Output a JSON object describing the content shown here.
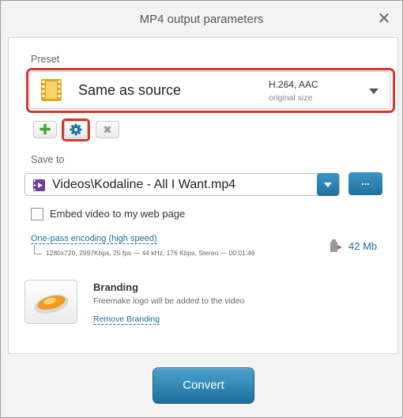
{
  "window": {
    "title": "MP4 output parameters",
    "close_icon": "close-icon"
  },
  "preset": {
    "label": "Preset",
    "name": "Same as source",
    "codec": "H.264, AAC",
    "size": "original size",
    "icon": "film-icon"
  },
  "preset_buttons": {
    "add_icon": "plus-icon",
    "edit_icon": "gear-icon",
    "delete_icon": "delete-icon"
  },
  "save_to": {
    "label": "Save to",
    "path": "Videos\\Kodaline - All I Want.mp4",
    "browse_label": "..."
  },
  "embed": {
    "label": "Embed video to my web page",
    "checked": false
  },
  "encoding": {
    "mode_link": "One-pass encoding (high speed)",
    "details": "1280x720, 2997Kbps, 25 fps — 44 kHz, 176 Kbps, Stereo — 00:01:46",
    "file_size": "42 Mb"
  },
  "branding": {
    "title": "Branding",
    "description": "Freemake logo will be added to the video",
    "remove_link": "Remove Branding"
  },
  "actions": {
    "convert_label": "Convert"
  },
  "colors": {
    "accent": "#2a7fb0",
    "highlight": "#d23a2a",
    "link": "#1d6ea3"
  }
}
